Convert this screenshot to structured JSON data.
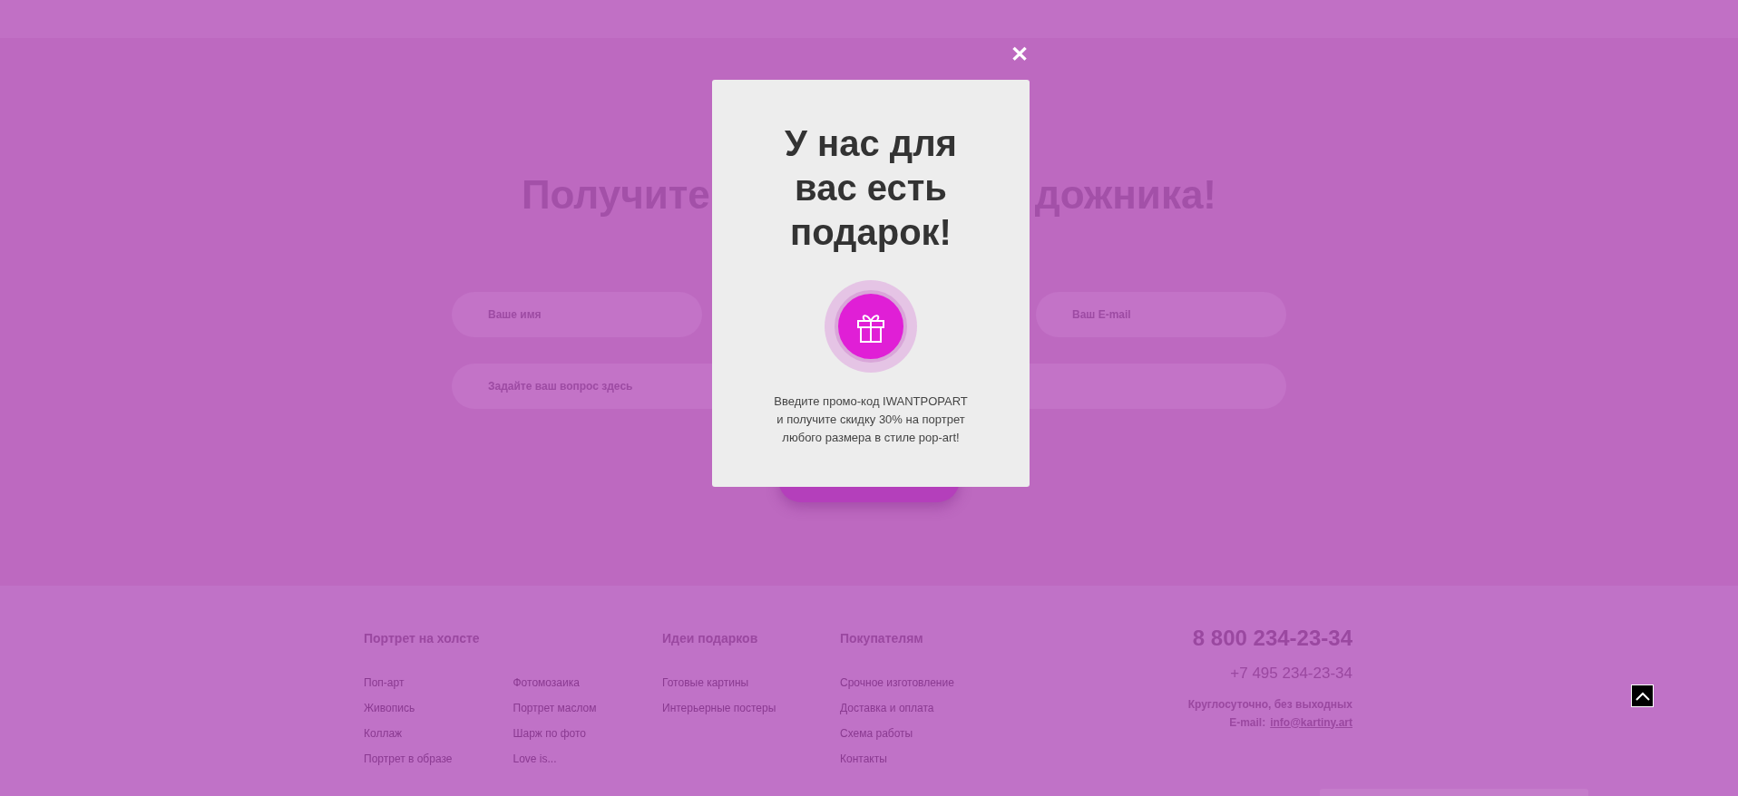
{
  "hero": {
    "heading_left": "Получите",
    "heading_right": "дожника!"
  },
  "form": {
    "fields": [
      {
        "placeholder": "Ваше имя"
      },
      {
        "placeholder": "Ваш E-mail"
      }
    ],
    "question": {
      "placeholder": "Задайте ваш вопрос здесь"
    }
  },
  "popup": {
    "close": "✕",
    "title": "У нас для вас есть подарок!",
    "text": "Введите промо-код IWANTPOPART\nи получите скидку 30% на портрет\nлюбого размера в стиле pop-art!"
  },
  "footer": {
    "columns": [
      {
        "title": "Портрет на холсте",
        "groups": [
          [
            "Поп-арт",
            "Живопись",
            "Коллаж",
            "Портрет в образе"
          ],
          [
            "Фотомозаика",
            "Портрет маслом",
            "Шарж по фото",
            "Love is..."
          ]
        ]
      },
      {
        "title": "Идеи подарков",
        "groups": [
          [
            "Готовые картины",
            "Интерьерные постеры"
          ]
        ]
      },
      {
        "title": "Покупателям",
        "groups": [
          [
            "Срочное изготовление",
            "Доставка и оплата",
            "Схема работы",
            "Контакты"
          ]
        ]
      }
    ],
    "contacts": {
      "phone_main": "8 800 234-23-34",
      "phone_second": "+7 495 234-23-34",
      "hours": "Круглосуточно, без выходных",
      "email_label": "E-mail:",
      "email": "info@kartiny.art"
    }
  }
}
